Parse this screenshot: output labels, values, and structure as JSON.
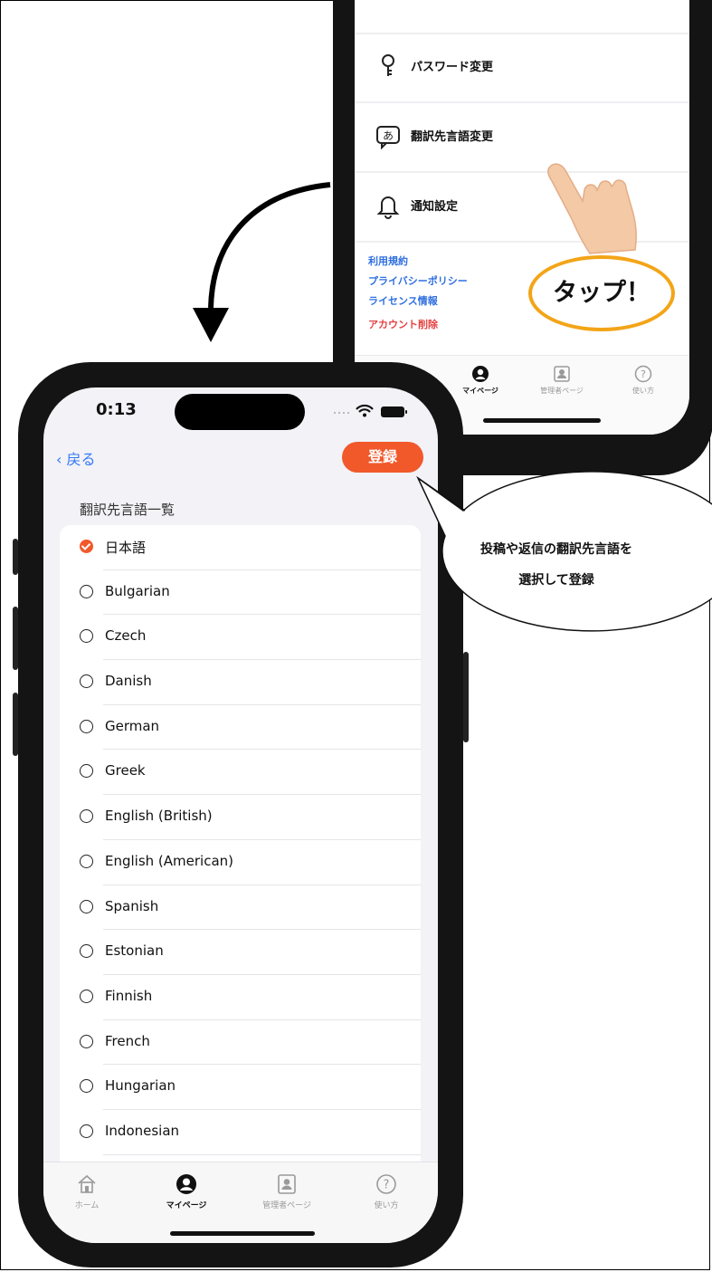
{
  "settings": {
    "rows": [
      {
        "icon": "key-icon",
        "label": "パスワード変更"
      },
      {
        "icon": "translate-icon",
        "label": "翻訳先言語変更"
      },
      {
        "icon": "bell-icon",
        "label": "通知設定"
      }
    ],
    "links": [
      "利用規約",
      "プライバシーポリシー",
      "ライセンス情報"
    ],
    "delete_account": "アカウント削除",
    "tabs": [
      "マイページ",
      "管理者ページ",
      "使い方"
    ]
  },
  "tap_callout": "タップ！",
  "status": {
    "time": "0:13"
  },
  "nav": {
    "back_label": "戻る",
    "register_label": "登録"
  },
  "section_title": "翻訳先言語一覧",
  "languages": [
    {
      "name": "日本語",
      "selected": true
    },
    {
      "name": "Bulgarian",
      "selected": false
    },
    {
      "name": "Czech",
      "selected": false
    },
    {
      "name": "Danish",
      "selected": false
    },
    {
      "name": "German",
      "selected": false
    },
    {
      "name": "Greek",
      "selected": false
    },
    {
      "name": "English (British)",
      "selected": false
    },
    {
      "name": "English (American)",
      "selected": false
    },
    {
      "name": "Spanish",
      "selected": false
    },
    {
      "name": "Estonian",
      "selected": false
    },
    {
      "name": "Finnish",
      "selected": false
    },
    {
      "name": "French",
      "selected": false
    },
    {
      "name": "Hungarian",
      "selected": false
    },
    {
      "name": "Indonesian",
      "selected": false
    }
  ],
  "tabbar": [
    {
      "label": "ホーム",
      "icon": "home-icon",
      "active": false
    },
    {
      "label": "マイページ",
      "icon": "person-icon",
      "active": true
    },
    {
      "label": "管理者ページ",
      "icon": "admin-icon",
      "active": false
    },
    {
      "label": "使い方",
      "icon": "help-icon",
      "active": false
    }
  ],
  "callout": {
    "line1": "投稿や返信の翻訳先言語を",
    "line2": "選択して登録"
  },
  "colors": {
    "accent": "#f1582a",
    "link": "#3478f6",
    "highlight_ring": "#f3a417",
    "danger": "#e54040"
  }
}
